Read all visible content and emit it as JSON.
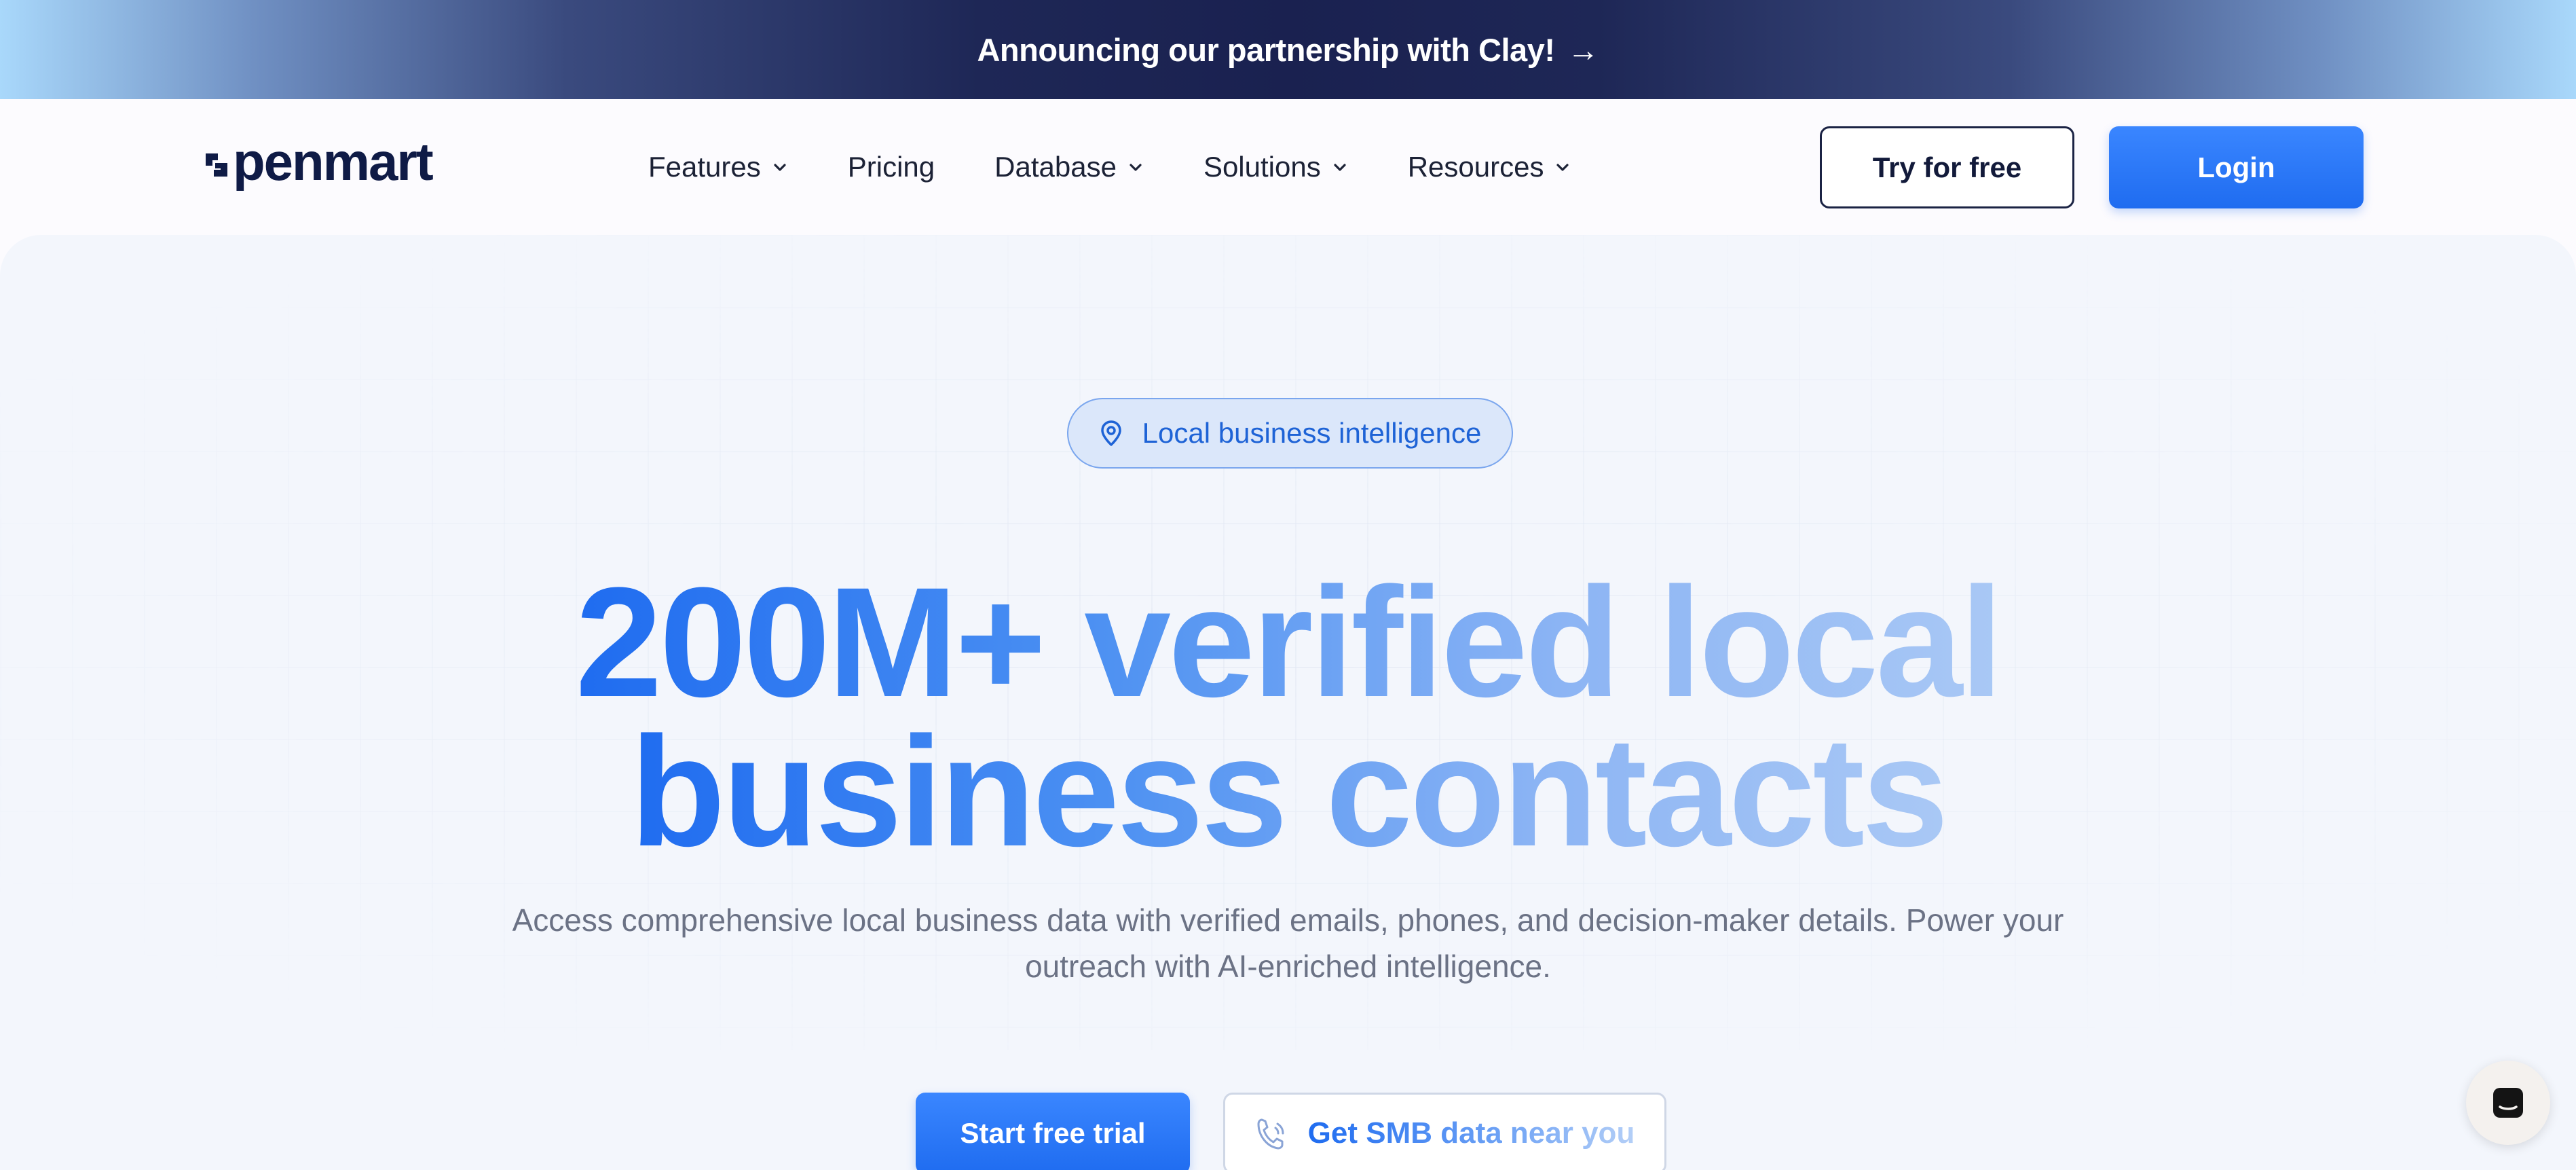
{
  "announcement": {
    "text": "Announcing our partnership with Clay!",
    "arrow": "→"
  },
  "nav": {
    "logo_text": "openmart",
    "logo_visible_text": "penmart",
    "items": [
      {
        "label": "Features",
        "has_dropdown": true
      },
      {
        "label": "Pricing",
        "has_dropdown": false
      },
      {
        "label": "Database",
        "has_dropdown": true
      },
      {
        "label": "Solutions",
        "has_dropdown": true
      },
      {
        "label": "Resources",
        "has_dropdown": true
      }
    ],
    "try_label": "Try for free",
    "login_label": "Login"
  },
  "hero": {
    "badge": "Local business intelligence",
    "headline_line1": "200M+ verified local",
    "headline_line2": "business contacts",
    "subtitle": "Access comprehensive local business data with verified emails, phones, and decision-maker details. Power your outreach with AI-enriched intelligence.",
    "cta_primary": "Start free trial",
    "cta_secondary": "Get SMB data near you"
  },
  "colors": {
    "brand_blue": "#1f6cf0",
    "navy": "#0f1b46",
    "hero_bg": "#f3f6fc"
  },
  "icons": {
    "badge": "map-pin-icon",
    "cta_secondary": "phone-call-icon",
    "chat": "chat-icon",
    "dropdown": "chevron-down-icon"
  }
}
